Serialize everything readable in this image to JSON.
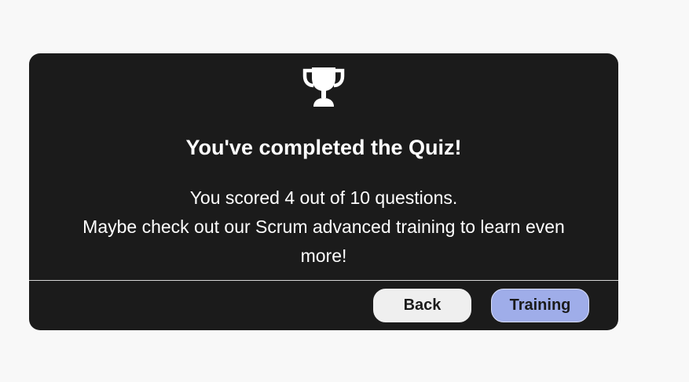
{
  "dialog": {
    "icon": "trophy-icon",
    "title": "You've completed the Quiz!",
    "score_line": "You scored 4 out of 10 questions.",
    "suggestion_line": "Maybe check out our Scrum advanced training to learn even more!"
  },
  "score": {
    "correct": 4,
    "total": 10
  },
  "actions": {
    "back_label": "Back",
    "training_label": "Training"
  },
  "colors": {
    "page_background": "#f8f8f8",
    "dialog_background": "#1b1b1b",
    "back_button": "#efefef",
    "training_button": "#9fade9"
  }
}
